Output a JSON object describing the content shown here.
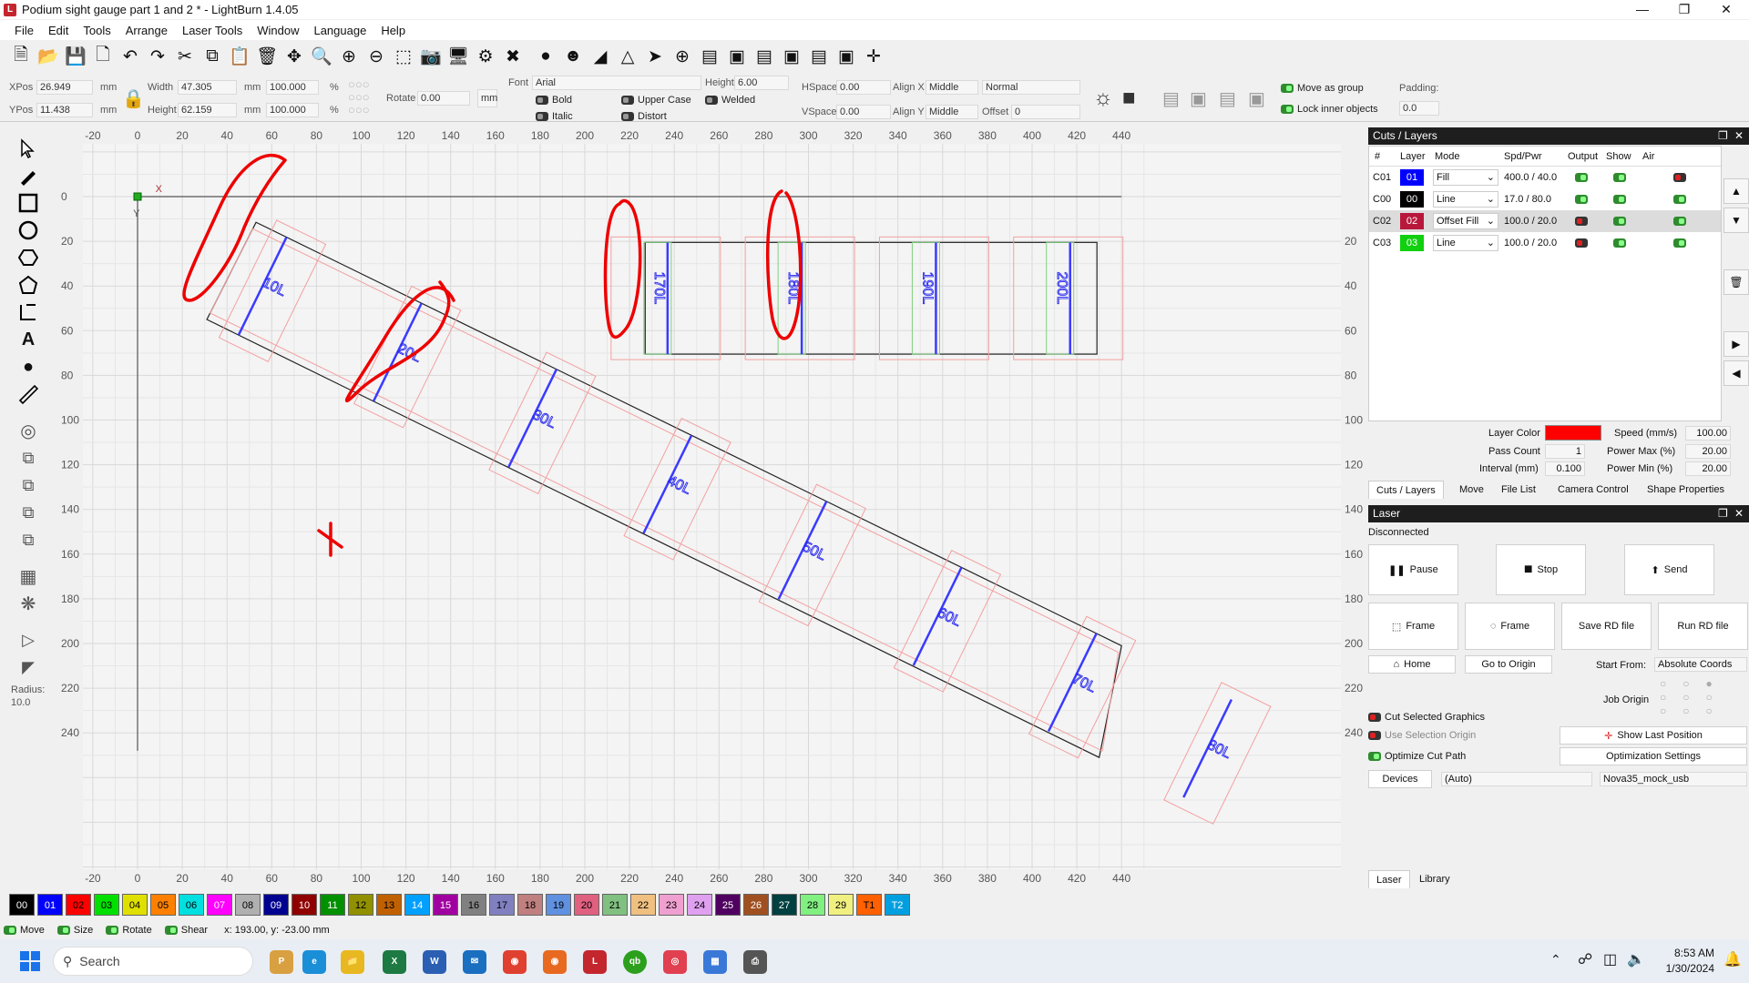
{
  "window": {
    "title": "Podium sight gauge part 1 and 2 * - LightBurn 1.4.05"
  },
  "menu": [
    "File",
    "Edit",
    "Tools",
    "Arrange",
    "Laser Tools",
    "Window",
    "Language",
    "Help"
  ],
  "props": {
    "xpos_label": "XPos",
    "xpos": "26.949",
    "ypos_label": "YPos",
    "ypos": "11.438",
    "unit": "mm",
    "width_label": "Width",
    "width": "47.305",
    "height_label": "Height",
    "height": "62.159",
    "pct_w": "100.000",
    "pct_h": "100.000",
    "pct": "%",
    "rotate_label": "Rotate",
    "rotate": "0.00",
    "mm_btn": "mm",
    "font_label": "Font",
    "font": "Arial",
    "fheight_label": "Height",
    "fheight": "6.00",
    "bold": "Bold",
    "italic": "Italic",
    "upper": "Upper Case",
    "distort": "Distort",
    "welded": "Welded",
    "hspace_label": "HSpace",
    "hspace": "0.00",
    "vspace_label": "VSpace",
    "vspace": "0.00",
    "alignx_label": "Align X",
    "alignx": "Middle",
    "aligny_label": "Align Y",
    "aligny": "Middle",
    "normal": "Normal",
    "offset_label": "Offset",
    "offset": "0",
    "move_group": "Move as group",
    "lock_inner": "Lock inner objects",
    "padding_label": "Padding:",
    "padding": "0.0"
  },
  "left_tools": {
    "radius_label": "Radius:",
    "radius": "10.0"
  },
  "ruler": {
    "x_ticks": [
      "-20",
      "0",
      "20",
      "40",
      "60",
      "80",
      "100",
      "120",
      "140",
      "160",
      "180",
      "200",
      "220",
      "240",
      "260",
      "280",
      "300",
      "320",
      "340",
      "360",
      "380",
      "400",
      "420",
      "440"
    ],
    "y_ticks": [
      "0",
      "20",
      "40",
      "60",
      "80",
      "100",
      "120",
      "140",
      "160",
      "180",
      "200",
      "220",
      "240"
    ],
    "y_ticks_right": [
      "20",
      "40",
      "60",
      "80",
      "100",
      "120",
      "140",
      "160",
      "180",
      "200",
      "220",
      "240"
    ],
    "axis_x": "X",
    "axis_y": "Y"
  },
  "shapes_labels": {
    "diag": [
      "10L",
      "20L",
      "30L",
      "40L",
      "50L",
      "60L",
      "70L",
      "80L"
    ],
    "horiz": [
      "170L",
      "180L",
      "190L",
      "200L"
    ]
  },
  "cuts_layers": {
    "title": "Cuts / Layers",
    "headers": [
      "#",
      "Layer",
      "Mode",
      "Spd/Pwr",
      "Output",
      "Show",
      "Air"
    ],
    "rows": [
      {
        "id": "C01",
        "layer": "01",
        "color": "#0000ff",
        "mode": "Fill",
        "spd": "400.0 / 40.0",
        "output": "on",
        "show": "on",
        "air": "red"
      },
      {
        "id": "C00",
        "layer": "00",
        "color": "#000000",
        "mode": "Line",
        "spd": "17.0 / 80.0",
        "output": "on",
        "show": "on",
        "air": "on"
      },
      {
        "id": "C02",
        "layer": "02",
        "color": "#b8183c",
        "mode": "Offset Fill",
        "spd": "100.0 / 20.0",
        "output": "red",
        "show": "on",
        "air": "on"
      },
      {
        "id": "C03",
        "layer": "03",
        "color": "#10d010",
        "mode": "Line",
        "spd": "100.0 / 20.0",
        "output": "red",
        "show": "on",
        "air": "on"
      }
    ],
    "layer_color_label": "Layer Color",
    "layer_color": "#ff0000",
    "speed_label": "Speed (mm/s)",
    "speed": "100.00",
    "pass_label": "Pass Count",
    "pass": "1",
    "pmax_label": "Power Max (%)",
    "pmax": "20.00",
    "interval_label": "Interval (mm)",
    "interval": "0.100",
    "pmin_label": "Power Min (%)",
    "pmin": "20.00",
    "tabs": [
      "Cuts / Layers",
      "Move",
      "File List",
      "Camera Control",
      "Shape Properties"
    ]
  },
  "laser": {
    "title": "Laser",
    "status": "Disconnected",
    "pause": "Pause",
    "stop": "Stop",
    "send": "Send",
    "frame1": "Frame",
    "frame2": "Frame",
    "save_rd": "Save RD file",
    "run_rd": "Run RD file",
    "home": "Home",
    "go_origin": "Go to Origin",
    "start_from_label": "Start From:",
    "start_from": "Absolute Coords",
    "job_origin": "Job Origin",
    "cut_selected": "Cut Selected Graphics",
    "use_sel_origin": "Use Selection Origin",
    "show_last": "Show Last Position",
    "optimize": "Optimize Cut Path",
    "opt_settings": "Optimization Settings",
    "devices": "Devices",
    "auto": "(Auto)",
    "device": "Nova35_mock_usb",
    "tabs": [
      "Laser",
      "Library"
    ]
  },
  "palette": [
    {
      "n": "00",
      "c": "#000000",
      "t": "#fff"
    },
    {
      "n": "01",
      "c": "#0000ff",
      "t": "#fff"
    },
    {
      "n": "02",
      "c": "#ff0000",
      "t": "#000"
    },
    {
      "n": "03",
      "c": "#00e000",
      "t": "#000"
    },
    {
      "n": "04",
      "c": "#e0e000",
      "t": "#000"
    },
    {
      "n": "05",
      "c": "#ff8000",
      "t": "#000"
    },
    {
      "n": "06",
      "c": "#00e0e0",
      "t": "#000"
    },
    {
      "n": "07",
      "c": "#ff00ff",
      "t": "#fff"
    },
    {
      "n": "08",
      "c": "#b0b0b0",
      "t": "#000"
    },
    {
      "n": "09",
      "c": "#000090",
      "t": "#fff"
    },
    {
      "n": "10",
      "c": "#900000",
      "t": "#fff"
    },
    {
      "n": "11",
      "c": "#009000",
      "t": "#fff"
    },
    {
      "n": "12",
      "c": "#909000",
      "t": "#000"
    },
    {
      "n": "13",
      "c": "#c06000",
      "t": "#000"
    },
    {
      "n": "14",
      "c": "#00a0ff",
      "t": "#fff"
    },
    {
      "n": "15",
      "c": "#a000a0",
      "t": "#fff"
    },
    {
      "n": "16",
      "c": "#808080",
      "t": "#000"
    },
    {
      "n": "17",
      "c": "#8080c0",
      "t": "#000"
    },
    {
      "n": "18",
      "c": "#c08080",
      "t": "#000"
    },
    {
      "n": "19",
      "c": "#6090e0",
      "t": "#000"
    },
    {
      "n": "20",
      "c": "#e06080",
      "t": "#000"
    },
    {
      "n": "21",
      "c": "#80c080",
      "t": "#000"
    },
    {
      "n": "22",
      "c": "#f0c080",
      "t": "#000"
    },
    {
      "n": "23",
      "c": "#f0a0d0",
      "t": "#000"
    },
    {
      "n": "24",
      "c": "#e0a0f0",
      "t": "#000"
    },
    {
      "n": "25",
      "c": "#500060",
      "t": "#fff"
    },
    {
      "n": "26",
      "c": "#a05020",
      "t": "#fff"
    },
    {
      "n": "27",
      "c": "#004040",
      "t": "#fff"
    },
    {
      "n": "28",
      "c": "#80f080",
      "t": "#000"
    },
    {
      "n": "29",
      "c": "#f0f080",
      "t": "#000"
    },
    {
      "n": "T1",
      "c": "#ff6000",
      "t": "#000"
    },
    {
      "n": "T2",
      "c": "#00a0e0",
      "t": "#fff"
    }
  ],
  "status": {
    "move": "Move",
    "size": "Size",
    "rotate": "Rotate",
    "shear": "Shear",
    "coords": "x: 193.00, y: -23.00 mm"
  },
  "taskbar": {
    "search": "Search",
    "time": "8:53 AM",
    "date": "1/30/2024"
  }
}
